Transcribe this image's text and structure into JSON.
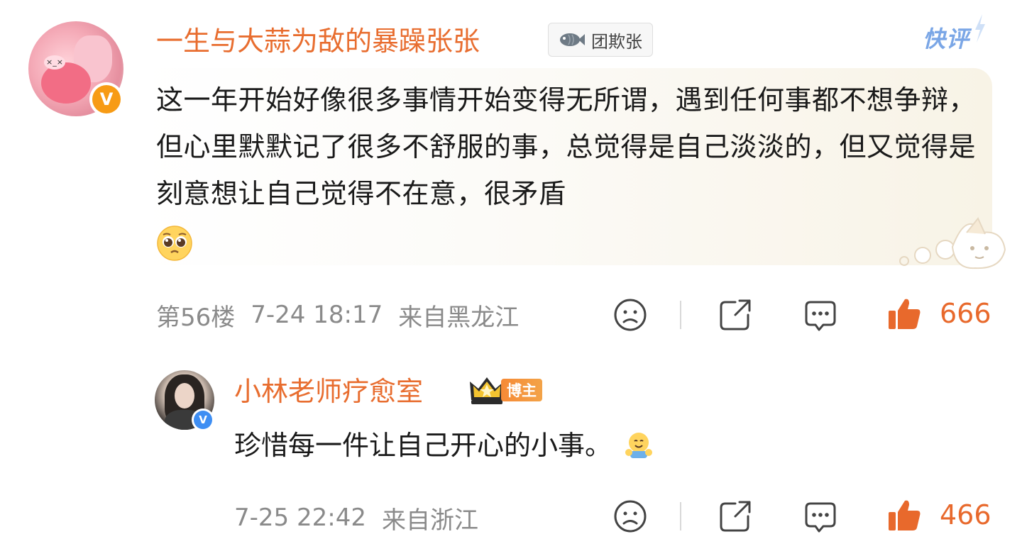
{
  "comment": {
    "username": "一生与大蒜为敌的暴躁张张",
    "fan_badge_label": "团欺张",
    "quick_review_label": "快评",
    "text": "这一年开始好像很多事情开始变得无所谓，遇到任何事都不想争辩，但心里默默记了很多不舒服的事，总觉得是自己淡淡的，但又觉得是刻意想让自己觉得不在意，很矛盾",
    "emoji": "pleading-face",
    "floor": "第56楼",
    "time": "7-24 18:17",
    "location": "来自黑龙江",
    "like_count": "666",
    "verified_badge": "V",
    "verified_color": "#f79b15"
  },
  "reply": {
    "username": "小林老师疗愈室",
    "role_badge": "博主",
    "text": "珍惜每一件让自己开心的小事。",
    "emoji": "hug-face",
    "time": "7-25 22:42",
    "location": "来自浙江",
    "like_count": "466",
    "verified_badge": "V",
    "verified_color": "#3e8ef3"
  },
  "colors": {
    "username": "#e86d2f",
    "meta_text": "#8a8a8a",
    "like_accent": "#e8692c",
    "quick_review": "#7aa6e6"
  },
  "icons": [
    "dislike-icon",
    "share-icon",
    "comment-icon",
    "like-icon",
    "fish-icon",
    "crown-icon"
  ]
}
